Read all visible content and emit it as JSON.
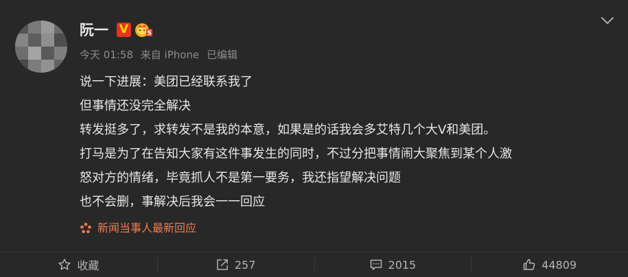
{
  "post": {
    "username": "阮一",
    "vip_badge": "V",
    "timestamp": "今天 01:58",
    "source": "来自 iPhone",
    "edited": "已编辑",
    "lines": [
      "说一下进展：美团已经联系我了",
      "但事情还没完全解决",
      "转发挺多了，求转发不是我的本意，如果是的话我会多艾特几个大V和美团。",
      "打马是为了在告知大家有这件事发生的同时，不过分把事情闹大聚焦到某个人激",
      "怒对方的情绪，毕竟抓人不是第一要务，我还指望解决问题",
      "也不会删，事解决后我会一一回应"
    ],
    "topic": "新闻当事人最新回应"
  },
  "actions": {
    "favorite": "收藏",
    "repost": "257",
    "comment": "2015",
    "like": "44809"
  },
  "colors": {
    "background": "#282828",
    "text": "#e6e6e6",
    "meta": "#8c8c8c",
    "topic": "#f07c52",
    "vip_red": "#e6341f",
    "vip_gold": "#ffd200"
  },
  "icons": {
    "avatar": "pixelated-avatar",
    "vip": "vip-v-icon",
    "member": "member-crown-icon",
    "chevron": "chevron-down-icon",
    "topic": "topic-flower-icon",
    "favorite": "star-icon",
    "repost": "repost-icon",
    "comment": "comment-icon",
    "like": "thumbs-up-icon"
  }
}
